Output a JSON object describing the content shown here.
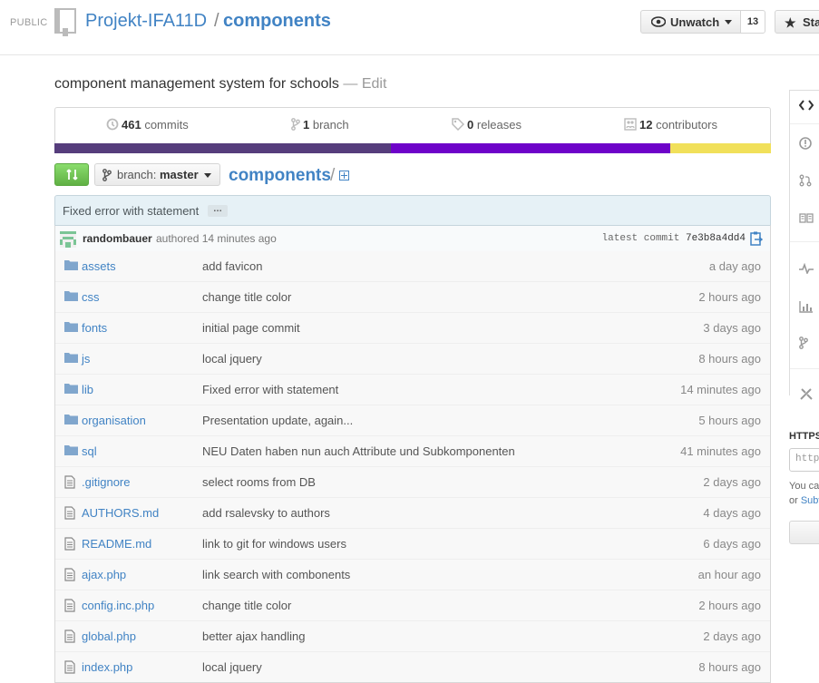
{
  "header": {
    "visibility": "PUBLIC",
    "owner": "Projekt-IFA11D",
    "separator": "/",
    "repo": "components",
    "unwatch_label": "Unwatch",
    "watch_count": "13",
    "star_label": "Star",
    "repo_icon": "repo-icon"
  },
  "description": {
    "text": "component management system for schools",
    "edit": "— Edit"
  },
  "summary": {
    "commits_count": "461",
    "commits_label": "commits",
    "branch_count": "1",
    "branch_label": "branch",
    "releases_count": "0",
    "releases_label": "releases",
    "contributors_count": "12",
    "contributors_label": "contributors"
  },
  "language_colors": [
    "#563d7c",
    "#6e03c9",
    "#f1e05a"
  ],
  "language_shares": [
    0.47,
    0.39,
    0.14
  ],
  "file_nav": {
    "branch_prefix": "branch:",
    "branch_value": "master",
    "breadcrumb_repo": "components",
    "breadcrumb_sep": "/"
  },
  "commit": {
    "message": "Fixed error with statement",
    "more": "…",
    "author": "randombauer",
    "authored": "authored 14 minutes ago",
    "latest_label": "latest commit",
    "sha": "7e3b8a4dd4"
  },
  "files": [
    {
      "type": "dir",
      "name": "assets",
      "message": "add favicon",
      "age": "a day ago"
    },
    {
      "type": "dir",
      "name": "css",
      "message": "change title color",
      "age": "2 hours ago"
    },
    {
      "type": "dir",
      "name": "fonts",
      "message": "initial page commit",
      "age": "3 days ago"
    },
    {
      "type": "dir",
      "name": "js",
      "message": "local jquery",
      "age": "8 hours ago"
    },
    {
      "type": "dir",
      "name": "lib",
      "message": "Fixed error with statement",
      "age": "14 minutes ago"
    },
    {
      "type": "dir",
      "name": "organisation",
      "message": "Presentation update, again...",
      "age": "5 hours ago"
    },
    {
      "type": "dir",
      "name": "sql",
      "message": "NEU Daten haben nun auch Attribute und Subkomponenten",
      "age": "41 minutes ago"
    },
    {
      "type": "file",
      "name": ".gitignore",
      "message": "select rooms from DB",
      "age": "2 days ago"
    },
    {
      "type": "file",
      "name": "AUTHORS.md",
      "message": "add rsalevsky to authors",
      "age": "4 days ago"
    },
    {
      "type": "file",
      "name": "README.md",
      "message": "link to git for windows users",
      "age": "6 days ago"
    },
    {
      "type": "file",
      "name": "ajax.php",
      "message": "link search with combonents",
      "age": "an hour ago"
    },
    {
      "type": "file",
      "name": "config.inc.php",
      "message": "change title color",
      "age": "2 hours ago"
    },
    {
      "type": "file",
      "name": "global.php",
      "message": "better ajax handling",
      "age": "2 days ago"
    },
    {
      "type": "file",
      "name": "index.php",
      "message": "local jquery",
      "age": "8 hours ago"
    }
  ],
  "clone": {
    "https_label": "HTTPS",
    "url_placeholder": "http",
    "help_line1": "You ca",
    "help_line2_prefix": "or ",
    "help_line2_link": "Subv"
  }
}
